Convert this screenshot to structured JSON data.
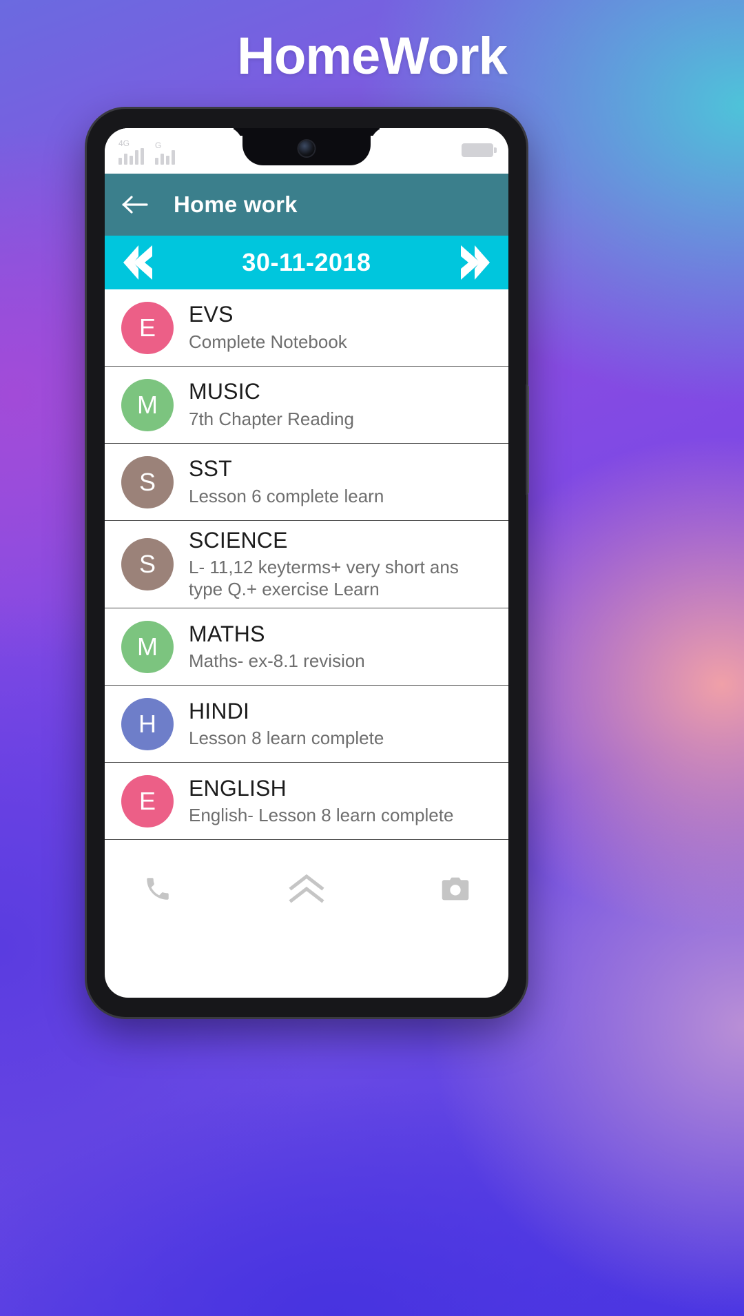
{
  "page": {
    "title": "HomeWork",
    "background_colors": {
      "purple": "#8d4ee0",
      "blue": "#4a35e2",
      "teal": "#4ec3d9",
      "pink": "#f0a0a8"
    }
  },
  "phone": {
    "status_bar": {
      "network_labels": [
        "4G",
        "G"
      ],
      "battery_icon": "battery-icon",
      "camera_icon": "front-camera"
    }
  },
  "appbar": {
    "back_icon": "back-arrow-icon",
    "title": "Home work",
    "color": "#3b7f8c"
  },
  "datebar": {
    "prev_icon": "chevron-left-icon",
    "next_icon": "chevron-right-icon",
    "date": "30-11-2018",
    "color": "#00c6dd"
  },
  "homework": {
    "items": [
      {
        "initial": "E",
        "subject": "EVS",
        "description": "Complete Notebook",
        "color": "#ec5f87"
      },
      {
        "initial": "M",
        "subject": "MUSIC",
        "description": "7th Chapter Reading",
        "color": "#7cc47f"
      },
      {
        "initial": "S",
        "subject": "SST",
        "description": "Lesson 6 complete learn",
        "color": "#9b8279"
      },
      {
        "initial": "S",
        "subject": "SCIENCE",
        "description": "L- 11,12 keyterms+ very short ans type Q.+ exercise Learn",
        "color": "#9b8279"
      },
      {
        "initial": "M",
        "subject": "MATHS",
        "description": "Maths- ex-8.1 revision",
        "color": "#7cc47f"
      },
      {
        "initial": "H",
        "subject": "HINDI",
        "description": "Lesson 8 learn complete",
        "color": "#6e7ec9"
      },
      {
        "initial": "E",
        "subject": "ENGLISH",
        "description": "English- Lesson 8 learn complete",
        "color": "#ec5f87"
      }
    ]
  },
  "bottomnav": {
    "phone_icon": "phone-icon",
    "expand_icon": "double-chevron-up-icon",
    "camera_icon": "camera-icon"
  }
}
